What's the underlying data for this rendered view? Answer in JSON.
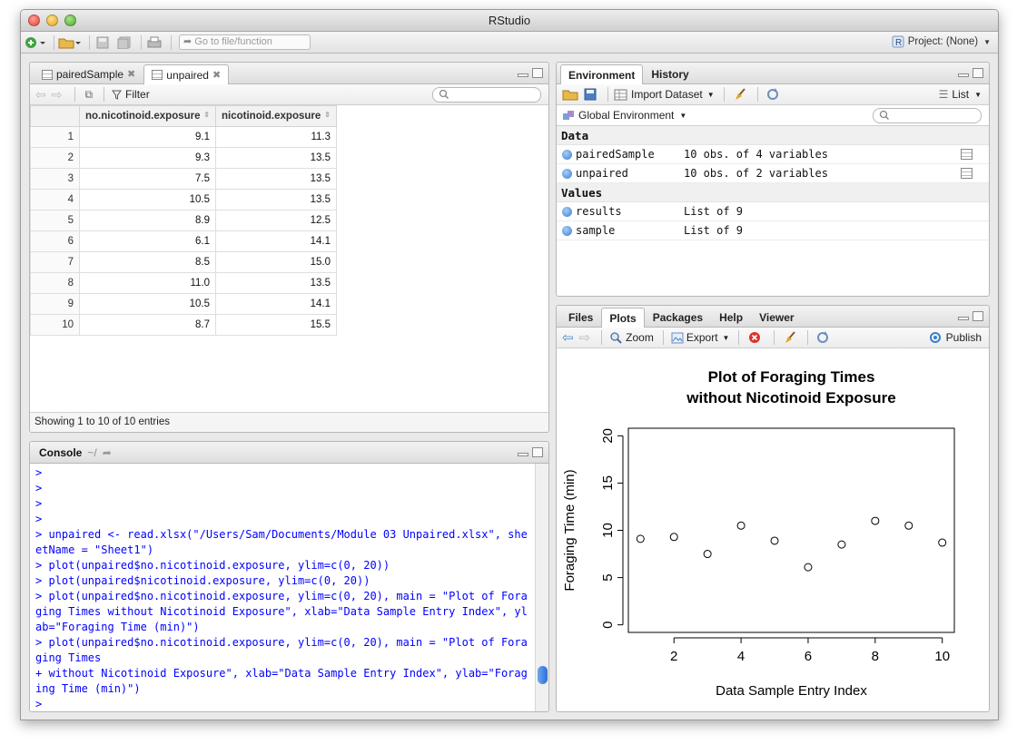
{
  "window": {
    "title": "RStudio"
  },
  "toolbar": {
    "goto_placeholder": "Go to file/function",
    "project_label": "Project: (None)"
  },
  "source": {
    "tabs": [
      {
        "label": "pairedSample"
      },
      {
        "label": "unpaired"
      }
    ],
    "filter_label": "Filter",
    "columns": [
      "no.nicotinoid.exposure",
      "nicotinoid.exposure"
    ],
    "rows": [
      [
        "1",
        "9.1",
        "11.3"
      ],
      [
        "2",
        "9.3",
        "13.5"
      ],
      [
        "3",
        "7.5",
        "13.5"
      ],
      [
        "4",
        "10.5",
        "13.5"
      ],
      [
        "5",
        "8.9",
        "12.5"
      ],
      [
        "6",
        "6.1",
        "14.1"
      ],
      [
        "7",
        "8.5",
        "15.0"
      ],
      [
        "8",
        "11.0",
        "13.5"
      ],
      [
        "9",
        "10.5",
        "14.1"
      ],
      [
        "10",
        "8.7",
        "15.5"
      ]
    ],
    "footer": "Showing 1 to 10 of 10 entries"
  },
  "console": {
    "title": "Console",
    "path": "~/",
    "lines": [
      ">",
      ">",
      ">",
      ">",
      "> unpaired <- read.xlsx(\"/Users/Sam/Documents/Module 03 Unpaired.xlsx\", sheetName = \"Sheet1\")",
      "> plot(unpaired$no.nicotinoid.exposure, ylim=c(0, 20))",
      "> plot(unpaired$nicotinoid.exposure, ylim=c(0, 20))",
      "> plot(unpaired$no.nicotinoid.exposure, ylim=c(0, 20), main = \"Plot of Foraging Times without Nicotinoid Exposure\", xlab=\"Data Sample Entry Index\", ylab=\"Foraging Time (min)\")",
      "> plot(unpaired$no.nicotinoid.exposure, ylim=c(0, 20), main = \"Plot of Foraging Times",
      "+ without Nicotinoid Exposure\", xlab=\"Data Sample Entry Index\", ylab=\"Foraging Time (min)\")",
      ">"
    ]
  },
  "environment": {
    "tabs": [
      "Environment",
      "History"
    ],
    "import_label": "Import Dataset",
    "view_label": "List",
    "scope_label": "Global Environment",
    "sections": [
      {
        "title": "Data",
        "rows": [
          {
            "name": "pairedSample",
            "value": "10 obs. of 4 variables"
          },
          {
            "name": "unpaired",
            "value": "10 obs. of 2 variables"
          }
        ]
      },
      {
        "title": "Values",
        "rows": [
          {
            "name": "results",
            "value": "List of 9"
          },
          {
            "name": "sample",
            "value": "List of 9"
          }
        ]
      }
    ]
  },
  "files": {
    "tabs": [
      "Files",
      "Plots",
      "Packages",
      "Help",
      "Viewer"
    ],
    "zoom_label": "Zoom",
    "export_label": "Export",
    "publish_label": "Publish"
  },
  "chart_data": {
    "type": "scatter",
    "title": "Plot of Foraging Times\nwithout Nicotinoid Exposure",
    "title_lines": [
      "Plot of Foraging Times",
      "without Nicotinoid Exposure"
    ],
    "xlabel": "Data Sample Entry Index",
    "ylabel": "Foraging Time (min)",
    "x": [
      1,
      2,
      3,
      4,
      5,
      6,
      7,
      8,
      9,
      10
    ],
    "y": [
      9.1,
      9.3,
      7.5,
      10.5,
      8.9,
      6.1,
      8.5,
      11.0,
      10.5,
      8.7
    ],
    "xlim": [
      0.64,
      10.36
    ],
    "ylim": [
      -0.8,
      20.8
    ],
    "xticks": [
      "2",
      "4",
      "6",
      "8",
      "10"
    ],
    "yticks": [
      "0",
      "5",
      "10",
      "15",
      "20"
    ],
    "grid": false,
    "marker": "open-circle"
  }
}
